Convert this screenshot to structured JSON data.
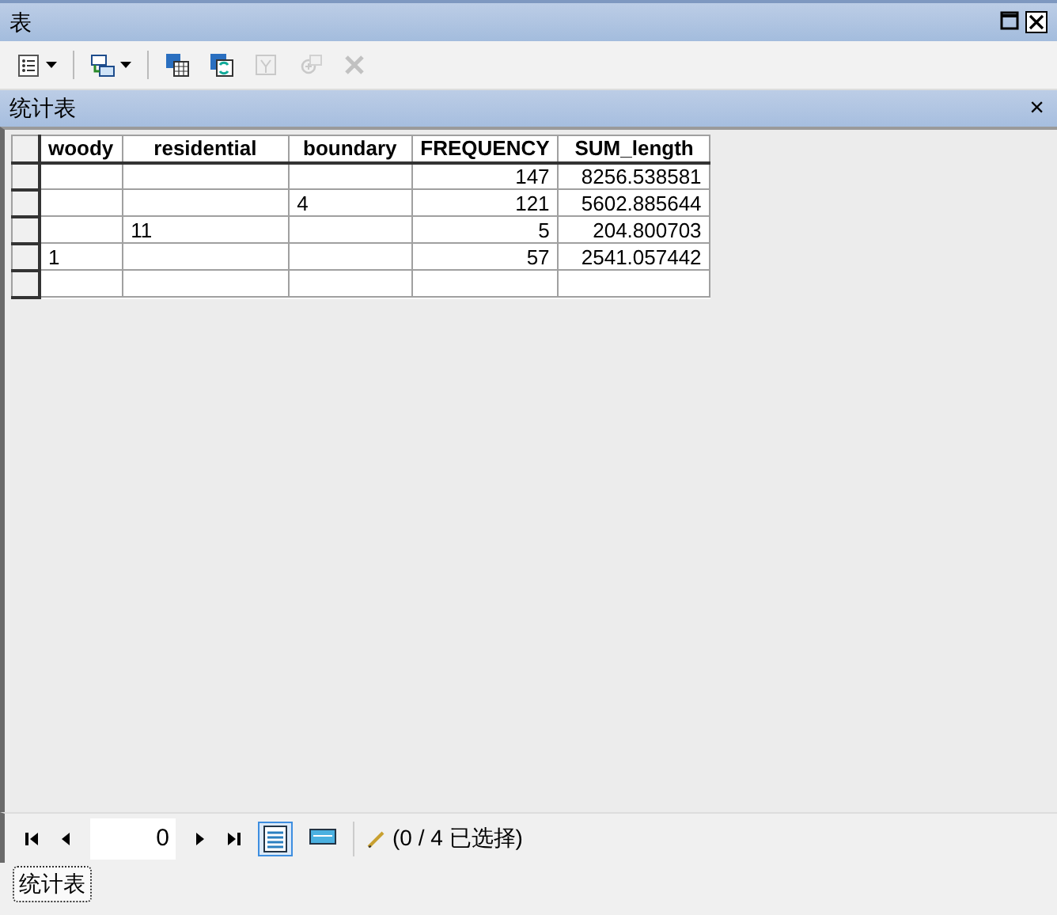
{
  "window": {
    "title": "表"
  },
  "toolbar": [
    {
      "kind": "options",
      "disabled": false,
      "dropdown": true
    },
    {
      "kind": "related",
      "disabled": false,
      "dropdown": true
    },
    {
      "kind": "select-by",
      "disabled": false,
      "dropdown": false
    },
    {
      "kind": "switch",
      "disabled": false,
      "dropdown": false
    },
    {
      "kind": "clear",
      "disabled": true,
      "dropdown": false
    },
    {
      "kind": "zoom",
      "disabled": true,
      "dropdown": false
    },
    {
      "kind": "delete",
      "disabled": true,
      "dropdown": false
    }
  ],
  "panel": {
    "title": "统计表",
    "close": "×"
  },
  "table": {
    "columns": [
      {
        "label": "woody",
        "kind": "text"
      },
      {
        "label": "residential",
        "kind": "text"
      },
      {
        "label": "boundary",
        "kind": "text"
      },
      {
        "label": "FREQUENCY",
        "kind": "number"
      },
      {
        "label": "SUM_length",
        "kind": "number"
      }
    ],
    "rows": [
      [
        "",
        "",
        "",
        "147",
        "8256.538581"
      ],
      [
        "",
        "",
        "4",
        "121",
        "5602.885644"
      ],
      [
        "",
        "11",
        "",
        "5",
        "204.800703"
      ],
      [
        "1",
        "",
        "",
        "57",
        "2541.057442"
      ],
      [
        "",
        "",
        "",
        "",
        ""
      ]
    ]
  },
  "navigator": {
    "record": "0",
    "views": [
      {
        "kind": "all",
        "selected": true
      },
      {
        "kind": "selected",
        "selected": false
      }
    ],
    "selection": "(0 / 4 已选择)"
  },
  "tabs": [
    {
      "label": "统计表",
      "selected": true
    }
  ]
}
